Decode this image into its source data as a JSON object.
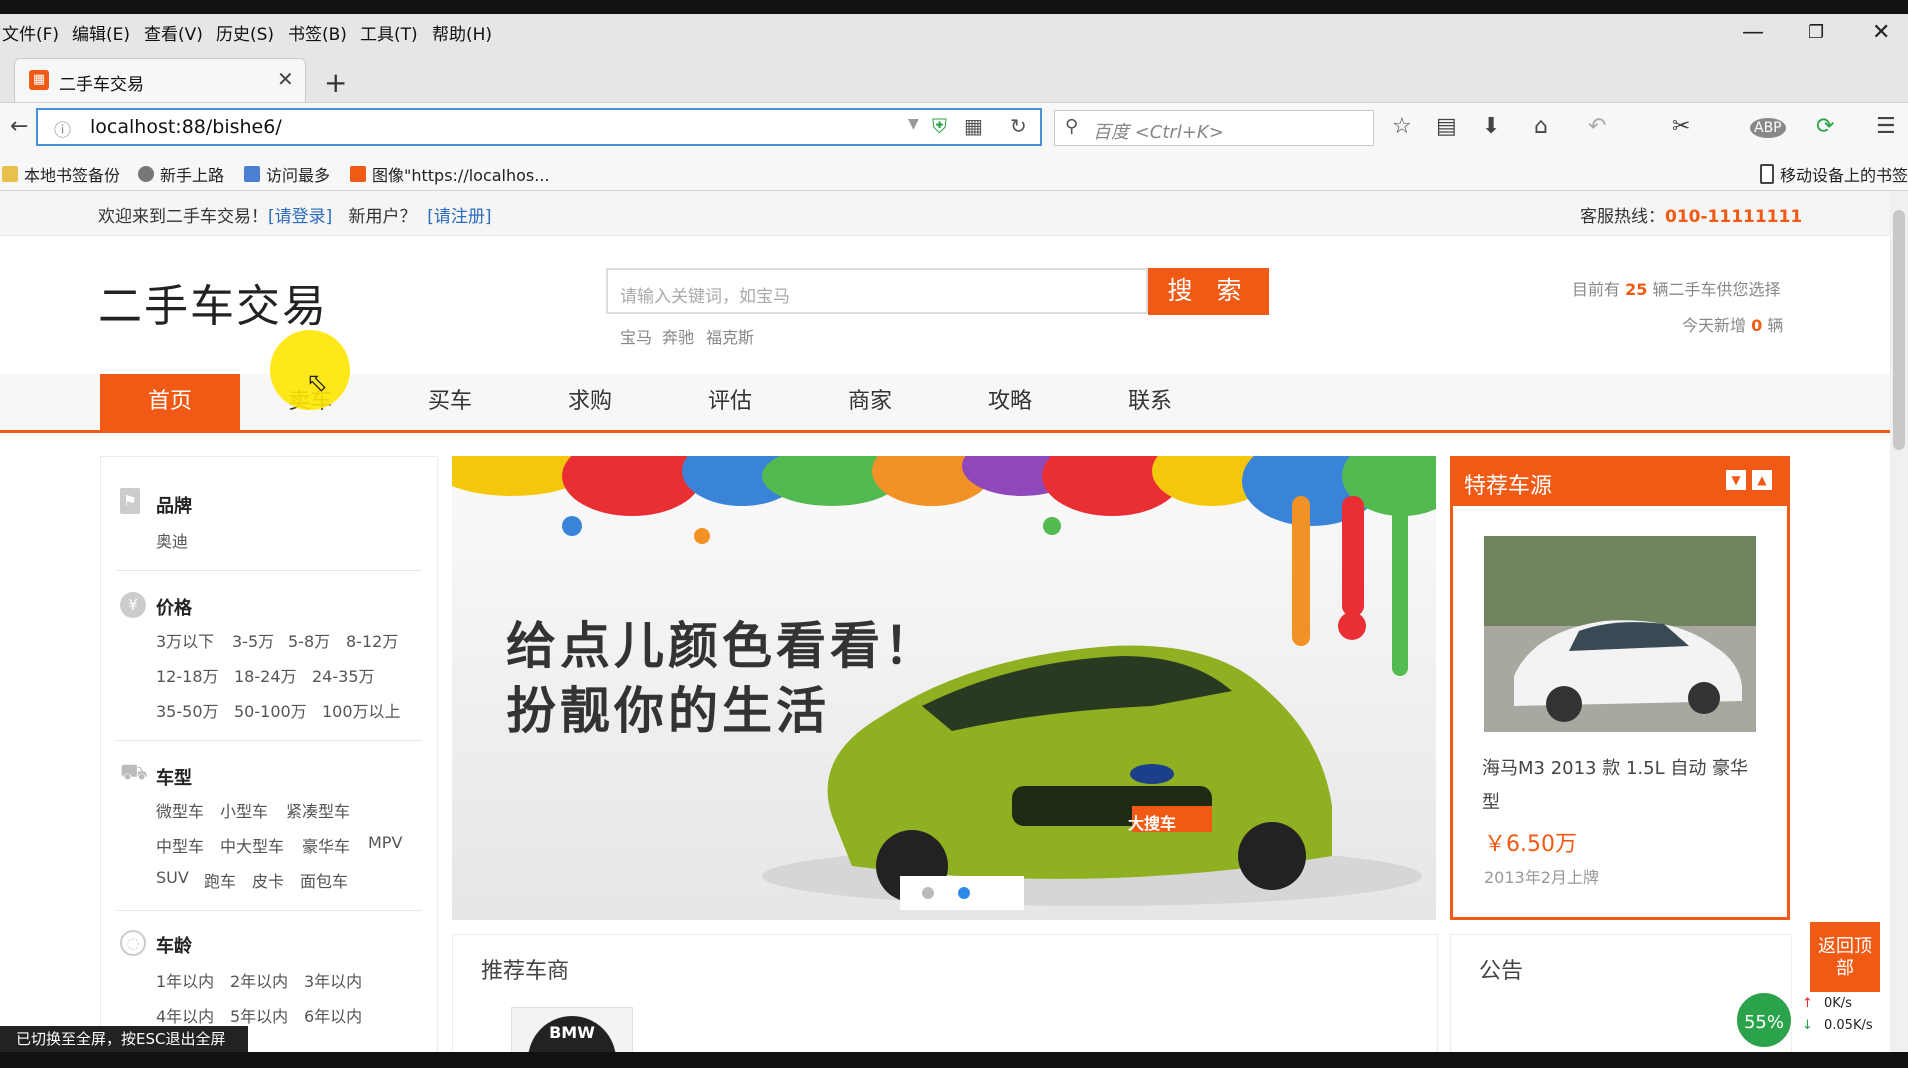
{
  "browser": {
    "menu": [
      "文件(F)",
      "编辑(E)",
      "查看(V)",
      "历史(S)",
      "书签(B)",
      "工具(T)",
      "帮助(H)"
    ],
    "tab_title": "二手车交易",
    "url": "localhost:88/bishe6/",
    "search_placeholder": "百度 <Ctrl+K>",
    "bookmarks": [
      "本地书签备份",
      "新手上路",
      "访问最多",
      "图像\"https://localhos...",
      "移动设备上的书签"
    ],
    "status_toast": "已切换至全屏，按ESC退出全屏",
    "net_percent": "55%",
    "net_up": "0K/s",
    "net_down": "0.05K/s"
  },
  "topbar": {
    "welcome": "欢迎来到二手车交易！",
    "login": "[请登录]",
    "new_user": "新用户？",
    "register": "[请注册]",
    "hotline_label": "客服热线：",
    "hotline": "010-11111111"
  },
  "header": {
    "logo": "二手车交易",
    "search_placeholder": "请输入关键词，如宝马",
    "search_button": "搜 索",
    "hot_words": [
      "宝马",
      "奔驰",
      "福克斯"
    ],
    "stats_prefix": "目前有",
    "stats_count": "25",
    "stats_suffix": "辆二手车供您选择",
    "today_prefix": "今天新增",
    "today_count": "0",
    "today_suffix": "辆"
  },
  "nav": [
    "首页",
    "卖车",
    "买车",
    "求购",
    "评估",
    "商家",
    "攻略",
    "联系"
  ],
  "sidebar": {
    "brand": {
      "title": "品牌",
      "items": [
        "奥迪"
      ]
    },
    "price": {
      "title": "价格",
      "rows": [
        [
          "3万以下",
          "3-5万",
          "5-8万",
          "8-12万"
        ],
        [
          "12-18万",
          "18-24万",
          "24-35万"
        ],
        [
          "35-50万",
          "50-100万",
          "100万以上"
        ]
      ]
    },
    "type": {
      "title": "车型",
      "rows": [
        [
          "微型车",
          "小型车",
          "紧凑型车"
        ],
        [
          "中型车",
          "中大型车",
          "豪华车",
          "MPV"
        ],
        [
          "SUV",
          "跑车",
          "皮卡",
          "面包车"
        ]
      ]
    },
    "age": {
      "title": "车龄",
      "rows": [
        [
          "1年以内",
          "2年以内",
          "3年以内"
        ],
        [
          "4年以内",
          "5年以内",
          "6年以内"
        ]
      ]
    }
  },
  "banner": {
    "line1": "给点儿颜色看看！",
    "line2": "扮靓你的生活",
    "plate": "大搜车",
    "active_slide": 2,
    "slide_count": 2
  },
  "featured": {
    "title": "特荐车源",
    "car_name": "海马M3 2013 款 1.5L 自动 豪华型",
    "price": "￥6.50万",
    "listed": "2013年2月上牌"
  },
  "sections": {
    "recommend_title": "推荐车商",
    "recommend_logo": "BMW",
    "notice_title": "公告",
    "back_top": "返回顶部"
  },
  "colors": {
    "accent": "#f05a14",
    "link": "#2b6cbf"
  }
}
